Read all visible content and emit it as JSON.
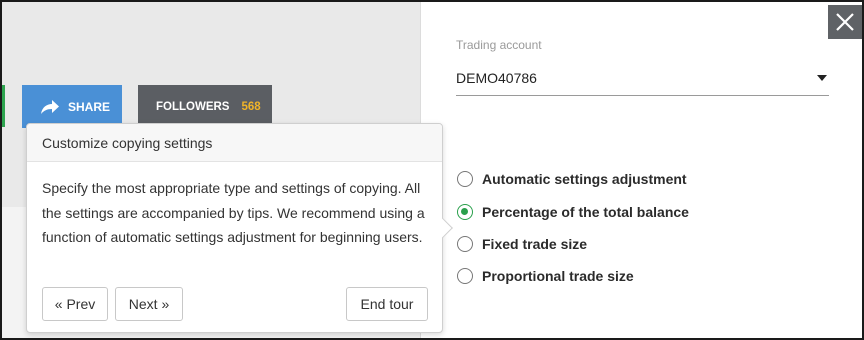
{
  "left": {
    "share_label": "SHARE",
    "followers_label": "FOLLOWERS",
    "followers_count": "568"
  },
  "tour": {
    "title": "Customize copying settings",
    "body": "Specify the most appropriate type and settings of copying. All the settings are accompanied by tips. We recommend using a function of automatic settings adjustment for beginning users.",
    "prev_label": "« Prev",
    "next_label": "Next »",
    "end_label": "End tour"
  },
  "panel": {
    "account_label": "Trading account",
    "account_value": "DEMO40786",
    "options": [
      {
        "label": "Automatic settings adjustment",
        "selected": false
      },
      {
        "label": "Percentage of the total balance",
        "selected": true
      },
      {
        "label": "Fixed trade size",
        "selected": false
      },
      {
        "label": "Proportional trade size",
        "selected": false
      }
    ]
  },
  "colors": {
    "share": "#4a90d6",
    "followers": "#5b5e63",
    "followers_count": "#f0b429",
    "radio_selected": "#2aa04c"
  },
  "icons": [
    "share-arrow-icon",
    "close-icon",
    "caret-down-icon"
  ]
}
